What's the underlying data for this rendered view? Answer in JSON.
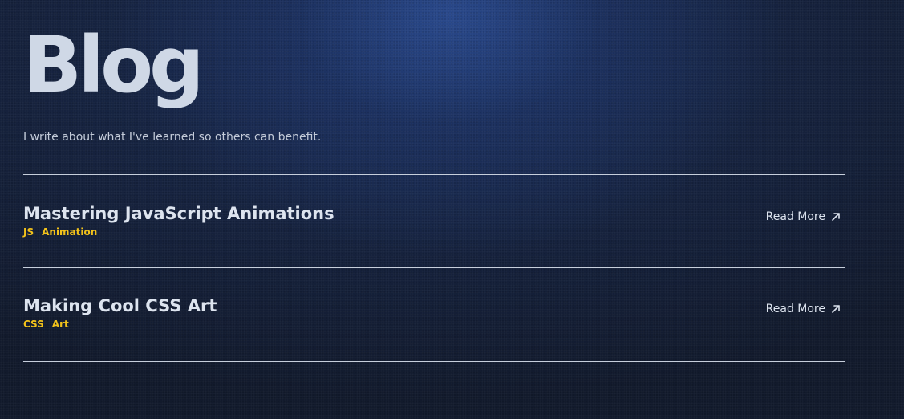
{
  "header": {
    "title": "Blog",
    "subtitle": "I write about what I've learned so others can benefit."
  },
  "posts": [
    {
      "title": "Mastering JavaScript Animations",
      "tags": [
        "JS",
        "Animation"
      ],
      "link_label": "Read More",
      "link_icon": "arrow-up-right-icon"
    },
    {
      "title": "Making Cool CSS Art",
      "tags": [
        "CSS",
        "Art"
      ],
      "link_label": "Read More",
      "link_icon": "arrow-up-right-icon"
    }
  ],
  "colors": {
    "background": "#121a2c",
    "glow": "#2c4e96",
    "text": "#dde4ef",
    "tag": "#f2c21b",
    "divider": "#c7cfdc"
  }
}
